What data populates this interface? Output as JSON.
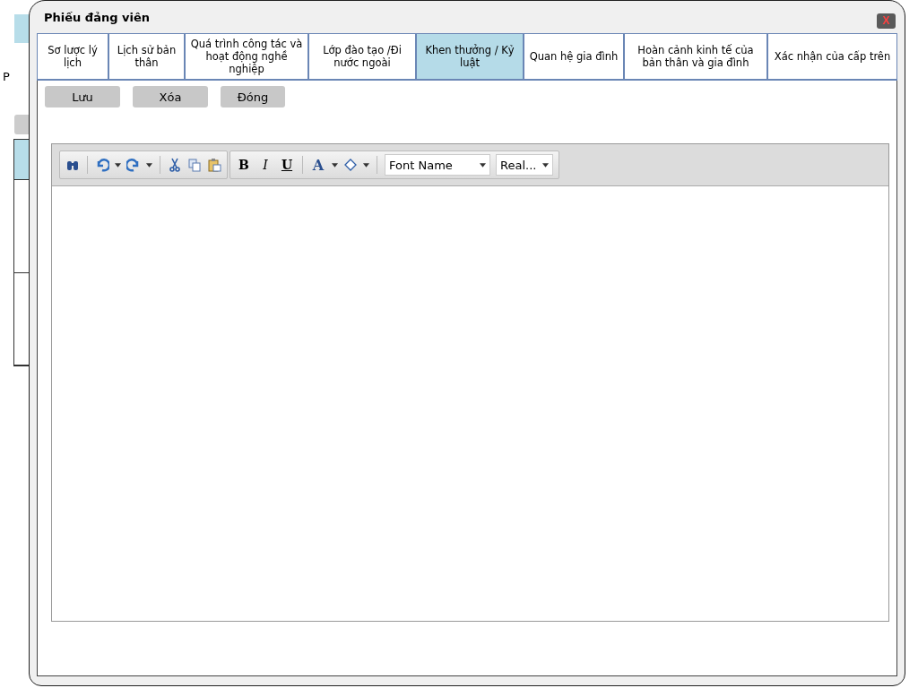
{
  "background": {
    "label": "P"
  },
  "window": {
    "title": "Phiếu đảng viên",
    "close": "X"
  },
  "tabs": [
    {
      "label": "Sơ lược lý lịch",
      "selected": false
    },
    {
      "label": "Lịch sử bản thân",
      "selected": false
    },
    {
      "label": "Quá trình công tác và hoạt động nghề nghiệp",
      "selected": false
    },
    {
      "label": "Lớp đào tạo /Đi nước ngoài",
      "selected": false
    },
    {
      "label": "Khen thưởng / Kỷ luật",
      "selected": true
    },
    {
      "label": "Quan hệ gia đình",
      "selected": false
    },
    {
      "label": "Hoàn cảnh kinh tế của bản thân và gia đình",
      "selected": false
    },
    {
      "label": "Xác nhận của cấp trên",
      "selected": false
    }
  ],
  "buttons": [
    "Lưu",
    "Xóa",
    "Đóng"
  ],
  "editor": {
    "bold": "B",
    "italic": "I",
    "underline": "U",
    "font_color": "A",
    "font_name": "Font Name",
    "font_size": "Real..."
  }
}
